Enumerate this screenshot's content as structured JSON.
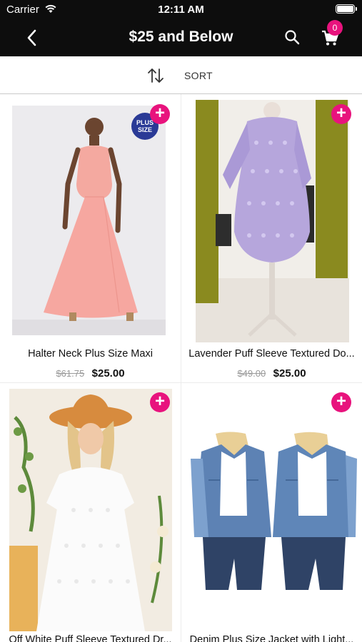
{
  "status_bar": {
    "carrier": "Carrier",
    "time": "12:11 AM"
  },
  "nav": {
    "title": "$25 and Below",
    "cart_count": "0"
  },
  "sort": {
    "label": "SORT"
  },
  "products": [
    {
      "name": "Halter Neck Plus Size Maxi",
      "old_price": "$61.75",
      "price": "$25.00",
      "badge": "PLUS SIZE"
    },
    {
      "name": "Lavender Puff Sleeve Textured Do...",
      "old_price": "$49.00",
      "price": "$25.00"
    },
    {
      "name": "Off White Puff Sleeve Textured Dr...",
      "old_price": "",
      "price": ""
    },
    {
      "name": "Denim Plus Size Jacket with Light...",
      "old_price": "",
      "price": ""
    }
  ],
  "colors": {
    "accent": "#e8137d",
    "header_bg": "#0d0d0d"
  }
}
